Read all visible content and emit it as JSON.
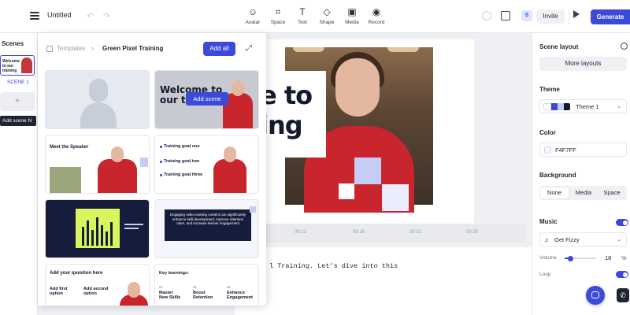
{
  "topbar": {
    "title": "Untitled",
    "undo": "↶",
    "redo": "↷",
    "tools": [
      {
        "label": "Avatar",
        "icon": "☺"
      },
      {
        "label": "Space",
        "icon": "⌗"
      },
      {
        "label": "Text",
        "icon": "T"
      },
      {
        "label": "Shape",
        "icon": "◇"
      },
      {
        "label": "Media",
        "icon": "▣"
      },
      {
        "label": "Record",
        "icon": "◉"
      }
    ],
    "user_initial": "S",
    "invite_label": "Invite",
    "generate_label": "Generate",
    "accent_color": "#3b4ad8"
  },
  "scenes": {
    "title": "Scenes",
    "scene_thumb_text": "Welcome to our training",
    "scene_label": "SCENE 1",
    "add_icon": "+",
    "tooltip": "Add scene N"
  },
  "templates": {
    "breadcrumb": "Templates",
    "chevron": "›",
    "name": "Green Pixel Training",
    "add_all_label": "Add all",
    "expand_icon": "⤢",
    "add_scene_label": "Add scene",
    "cards": {
      "welcome_title": "Welcome to our tra",
      "speaker_title": "Meet the Speaker",
      "goals": [
        "Training goal one",
        "Training goal two",
        "Training goal three"
      ],
      "engage_text": "Engaging video training content can significantly enhance skill development, improve retention rates, and increase learner engagement",
      "question_title": "Add your question here",
      "options": [
        "Add first option",
        "Add second option"
      ],
      "learnings_title": "Key learnings:",
      "learnings": [
        {
          "num": "01",
          "text": "Master New Skills"
        },
        {
          "num": "02",
          "text": "Boost Retention"
        },
        {
          "num": "03",
          "text": "Enhance Engagement"
        }
      ]
    }
  },
  "canvas": {
    "title_text": "e to\ning",
    "timeline_ticks": [
      "00:12",
      "00:16",
      "00:21",
      "00:25"
    ],
    "script_text": "l Training. Let's dive into this"
  },
  "right_panel": {
    "scene_layout_title": "Scene layout",
    "more_layouts_label": "More layouts",
    "theme_title": "Theme",
    "theme_value": "Theme 1",
    "theme_swatch": [
      "#ffffff",
      "#3b4ad8",
      "#c5cdf7",
      "#141a2e"
    ],
    "color_title": "Color",
    "color_value": "F4F7FF",
    "background_title": "Background",
    "background_options": [
      "None",
      "Media",
      "Space"
    ],
    "background_selected": "None",
    "music_title": "Music",
    "music_enabled": true,
    "music_track": "Get Fizzy",
    "volume_label": "Volume",
    "volume_value": "18",
    "volume_fraction": 0.18,
    "volume_unit": "%",
    "loop_label": "Loop",
    "loop_enabled": true
  }
}
